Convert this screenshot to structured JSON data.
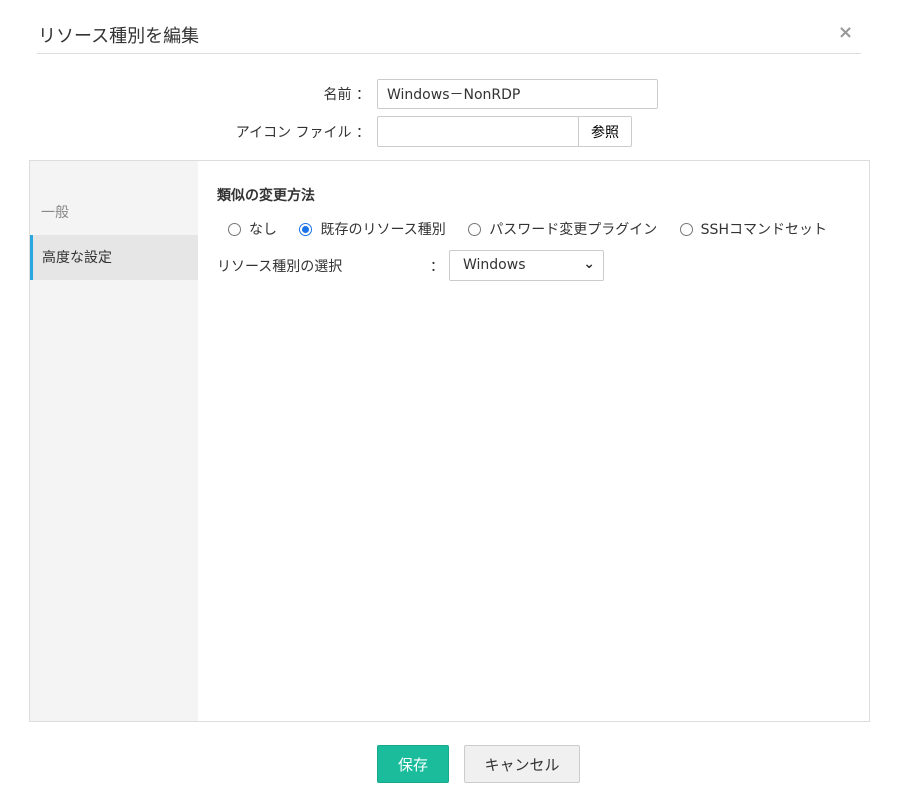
{
  "dialog": {
    "title": "リソース種別を編集",
    "close": "×"
  },
  "form": {
    "name_label": "名前 ：",
    "name_value": "Windows－NonRDP",
    "icon_label": "アイコン ファイル ：",
    "icon_value": "",
    "browse": "参照"
  },
  "sidebar": {
    "items": [
      {
        "label": "一般"
      },
      {
        "label": "高度な設定"
      }
    ]
  },
  "content": {
    "section_title": "類似の変更方法",
    "radios": [
      {
        "label": "なし",
        "checked": false
      },
      {
        "label": "既存のリソース種別",
        "checked": true
      },
      {
        "label": "パスワード変更プラグイン",
        "checked": false
      },
      {
        "label": "SSHコマンドセット",
        "checked": false
      }
    ],
    "select_label": "リソース種別の選択",
    "colon": "：",
    "select_value": "Windows"
  },
  "buttons": {
    "save": "保存",
    "cancel": "キャンセル"
  }
}
